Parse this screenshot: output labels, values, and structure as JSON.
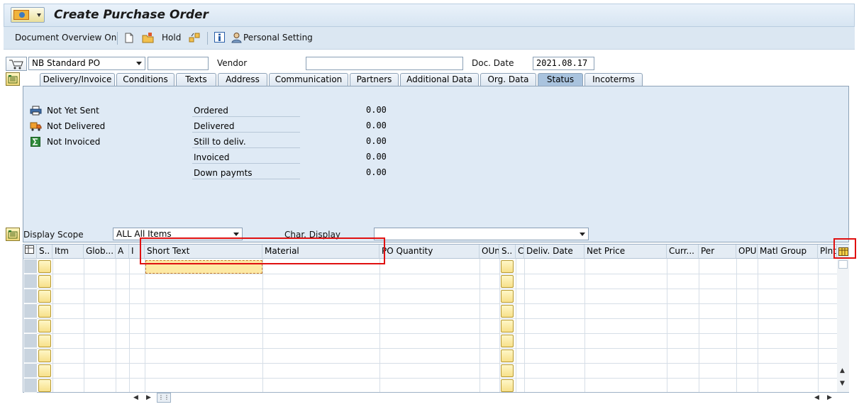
{
  "window": {
    "title": "Create Purchase Order"
  },
  "toolbar": {
    "document_overview": "Document Overview On",
    "hold": "Hold",
    "personal_setting": "Personal Setting"
  },
  "header": {
    "order_type": "NB Standard PO",
    "po_number": "",
    "vendor_label": "Vendor",
    "vendor_value": "",
    "doc_date_label": "Doc. Date",
    "doc_date_value": "2021.08.17"
  },
  "tabs": [
    {
      "label": "Delivery/Invoice"
    },
    {
      "label": "Conditions"
    },
    {
      "label": "Texts"
    },
    {
      "label": "Address"
    },
    {
      "label": "Communication"
    },
    {
      "label": "Partners"
    },
    {
      "label": "Additional Data"
    },
    {
      "label": "Org. Data"
    },
    {
      "label": "Status"
    },
    {
      "label": "Incoterms"
    }
  ],
  "status_panel": {
    "statuses": [
      {
        "label": "Not Yet Sent",
        "icon": "printer-icon"
      },
      {
        "label": "Not Delivered",
        "icon": "truck-icon"
      },
      {
        "label": "Not Invoiced",
        "icon": "sigma-icon"
      }
    ],
    "values": [
      {
        "label": "Ordered",
        "value": "0.00"
      },
      {
        "label": "Delivered",
        "value": "0.00"
      },
      {
        "label": "Still to deliv.",
        "value": "0.00"
      },
      {
        "label": "Invoiced",
        "value": "0.00"
      },
      {
        "label": "Down paymts",
        "value": "0.00"
      }
    ]
  },
  "items": {
    "display_scope_label": "Display Scope",
    "display_scope_value": "ALL All Items",
    "char_display_label": "Char. Display",
    "char_display_value": "",
    "columns": [
      "S..",
      "Itm",
      "Glob...",
      "A",
      "I",
      "Short Text",
      "Material",
      "PO Quantity",
      "OUn",
      "S..",
      "C",
      "Deliv. Date",
      "Net Price",
      "Curr...",
      "Per",
      "OPU",
      "Matl Group",
      "Plnt"
    ]
  },
  "colors": {
    "highlight": "#e01010",
    "active_tab": "#a9c3de",
    "panel": "#dfeaf5"
  }
}
